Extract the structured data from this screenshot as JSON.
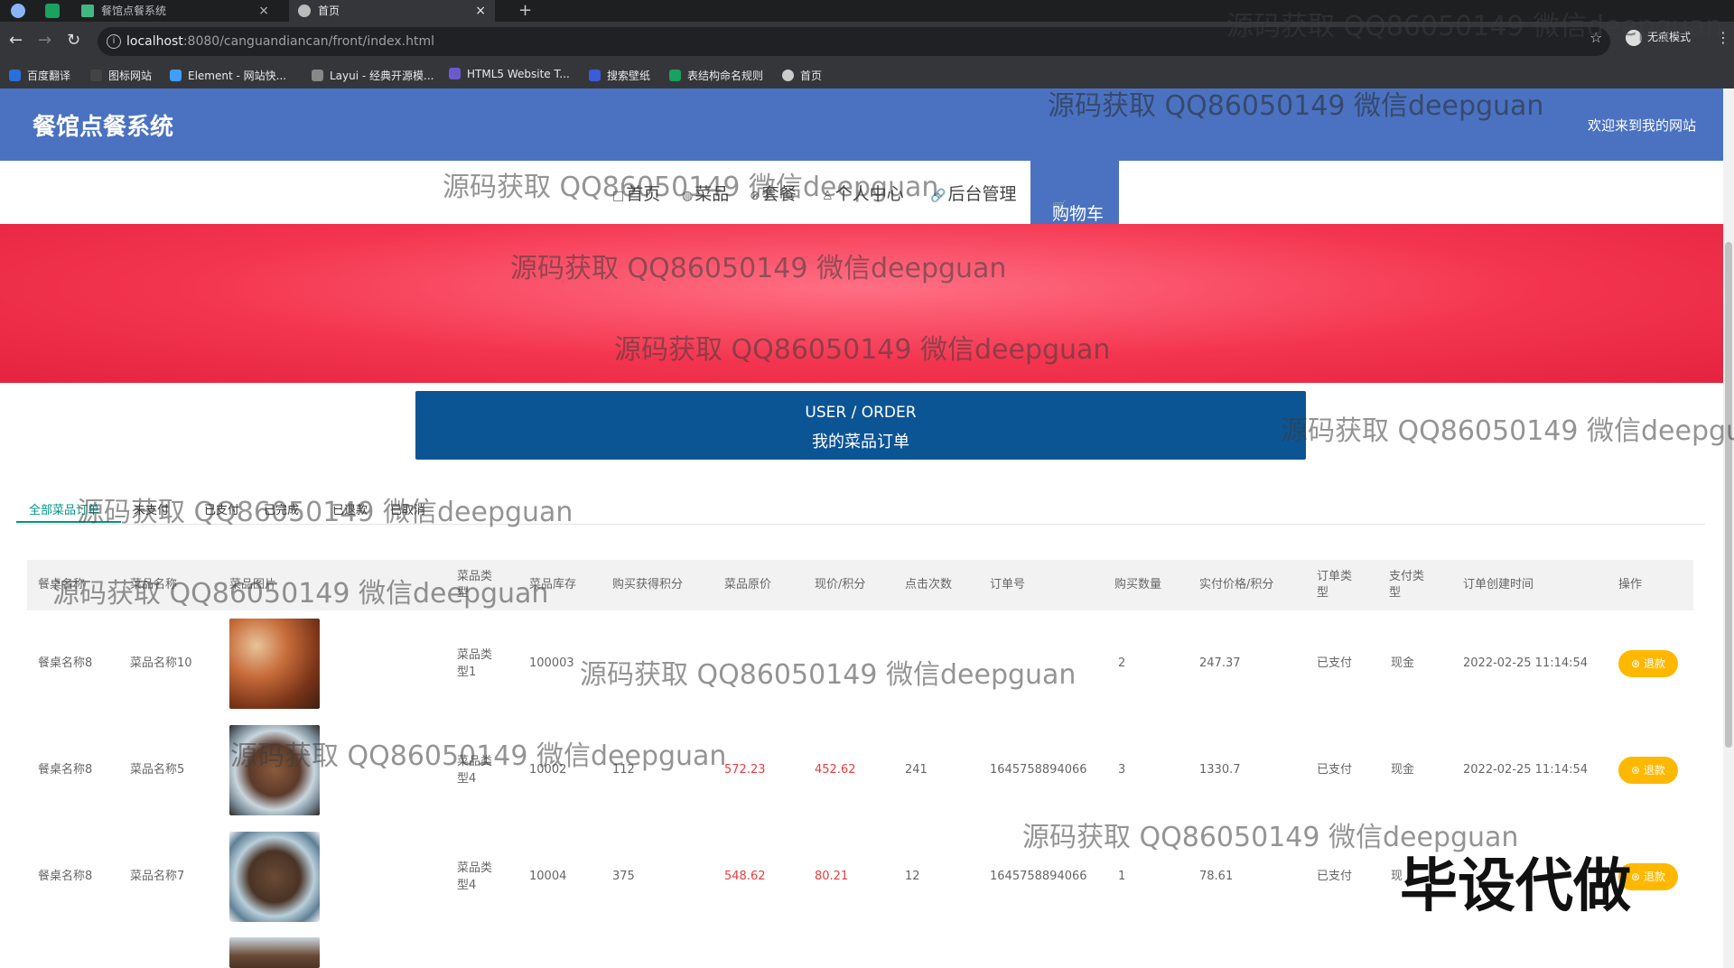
{
  "browser": {
    "tabs": [
      {
        "title": "餐馆点餐系统",
        "close": "×",
        "active": false
      },
      {
        "title": "首页",
        "close": "×",
        "active": true
      }
    ],
    "new_tab": "+",
    "url_host": "localhost",
    "url_rest": ":8080/canguandiancan/front/index.html",
    "incognito_label": "无痕模式",
    "bookmarks": [
      {
        "label": "百度翻译",
        "color": "#2a6fdb"
      },
      {
        "label": "图标网站",
        "color": "#444444"
      },
      {
        "label": "Element - 网站快...",
        "color": "#409eff"
      },
      {
        "label": "Layui - 经典开源模...",
        "color": "#888888"
      },
      {
        "label": "HTML5 Website T...",
        "color": "#6a5acd"
      },
      {
        "label": "搜索壁纸",
        "color": "#3b5bdb"
      },
      {
        "label": "表结构命名规则",
        "color": "#19a15f"
      },
      {
        "label": "首页",
        "color": "#cccccc"
      }
    ]
  },
  "site": {
    "title": "餐馆点餐系统",
    "welcome": "欢迎来到我的网站"
  },
  "nav": {
    "items": [
      {
        "icon": "□",
        "label": "首页",
        "icon_name": "home-icon"
      },
      {
        "icon": "◍",
        "label": "菜品",
        "icon_name": "dish-icon"
      },
      {
        "icon": "⊘",
        "label": "套餐",
        "icon_name": "combo-icon"
      },
      {
        "icon": "♙",
        "label": "个人中心",
        "icon_name": "user-icon"
      },
      {
        "icon": "🔗",
        "label": "后台管理",
        "icon_name": "link-icon"
      }
    ],
    "active": {
      "icon": "🛒",
      "label": "购物车"
    }
  },
  "order_button": {
    "en": "USER / ORDER",
    "zh": "我的菜品订单"
  },
  "tabs": [
    "全部菜品订单",
    "未支付",
    "已支付",
    "已完成",
    "已退款",
    "已取消"
  ],
  "table": {
    "headers": [
      "餐桌名称",
      "菜品名称",
      "菜品图片",
      "菜品类型",
      "菜品库存",
      "购买获得积分",
      "菜品原价",
      "现价/积分",
      "点击次数",
      "订单号",
      "购买数量",
      "实付价格/积分",
      "订单类型",
      "支付类型",
      "订单创建时间",
      "操作"
    ],
    "rows": [
      {
        "table": "餐桌名称8",
        "dish": "菜品名称10",
        "img_color": "#b5542e",
        "type": "菜品类型1",
        "stock": "100003",
        "points": "",
        "orig": "",
        "price": "",
        "clicks": "",
        "order_no": "",
        "qty": "2",
        "paid": "247.37",
        "order_type": "已支付",
        "pay_type": "现金",
        "created": "2022-02-25 11:14:54",
        "action": "退款"
      },
      {
        "table": "餐桌名称8",
        "dish": "菜品名称5",
        "img_color": "#5b3a2a",
        "type": "菜品类型4",
        "stock": "10002",
        "points": "112",
        "orig": "572.23",
        "price": "452.62",
        "clicks": "241",
        "order_no": "1645758894066",
        "qty": "3",
        "paid": "1330.7",
        "order_type": "已支付",
        "pay_type": "现金",
        "created": "2022-02-25 11:14:54",
        "action": "退款"
      },
      {
        "table": "餐桌名称8",
        "dish": "菜品名称7",
        "img_color": "#4a3325",
        "type": "菜品类型4",
        "stock": "10004",
        "points": "375",
        "orig": "548.62",
        "price": "80.21",
        "clicks": "12",
        "order_no": "1645758894066",
        "qty": "1",
        "paid": "78.61",
        "order_type": "已支付",
        "pay_type": "现",
        "created": "",
        "action": "退款"
      }
    ]
  },
  "watermarks": {
    "text": "源码获取 QQ86050149 微信deepguan",
    "clipped": "源码获取 QQ86050149 微信deepgu",
    "stamp": "毕设代做"
  },
  "colors": {
    "header": "#4a72c1",
    "banner": "#f4354f",
    "order_button": "#0c5595",
    "tab_active": "#009688",
    "refund": "#ffb800",
    "price_red": "#e83d3d"
  }
}
